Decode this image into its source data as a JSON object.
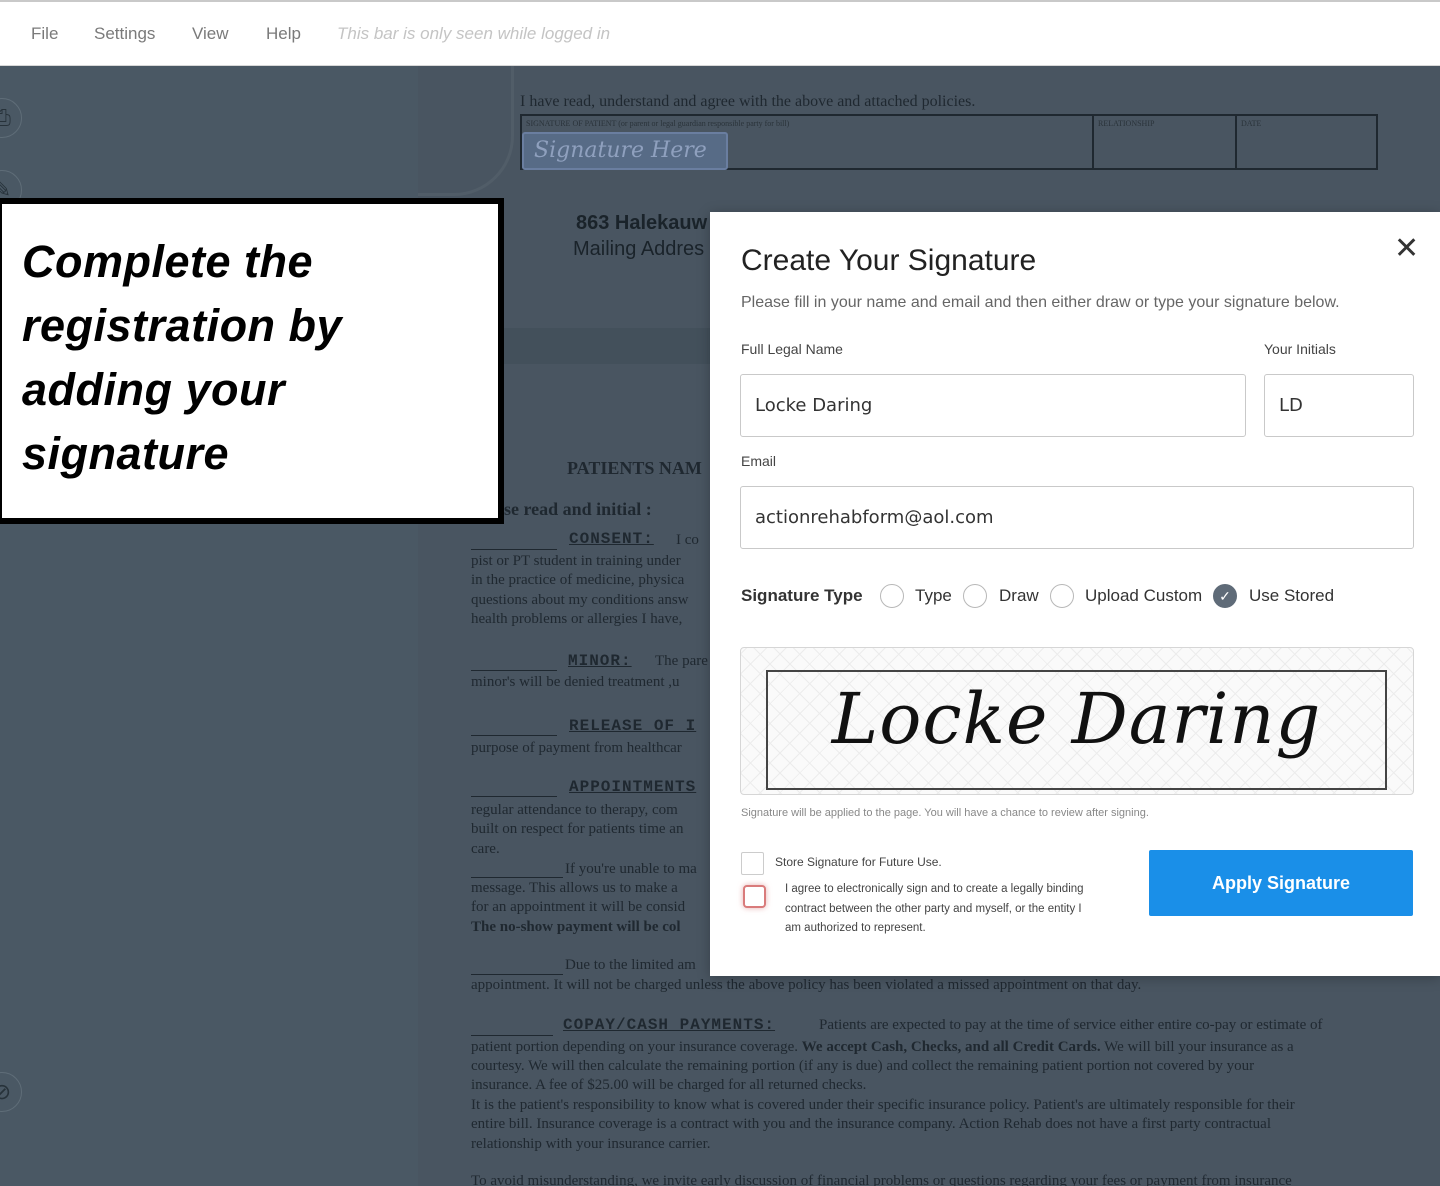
{
  "menubar": {
    "items": [
      "File",
      "Settings",
      "View",
      "Help"
    ],
    "note": "This bar is only seen while logged in"
  },
  "document": {
    "agree_line": "I have read, understand and agree with the above and attached policies.",
    "sig_header": "SIGNATURE OF PATIENT (or parent or legal guardian responsible party for bill)",
    "relationship_header": "RELATIONSHIP",
    "date_header": "DATE",
    "signature_here": "Signature Here",
    "address_line": "863 Halekauw",
    "mailing_line": "Mailing Addres",
    "patients_name": "PATIENTS NAM",
    "read_initial": "se read and initial :",
    "consent_head": "CONSENT:",
    "consent_lines": [
      "I co",
      "pist or PT student in training under",
      "in the practice of medicine, physica",
      "questions about my conditions answ",
      "health problems or allergies I have,"
    ],
    "minor_head": "MINOR:",
    "minor_lines": [
      "The pare",
      "minor's will be denied treatment ,u"
    ],
    "release_head": "RELEASE OF I",
    "release_line": "purpose of payment from healthcar",
    "appointments_head": "APPOINTMENTS",
    "appointments_lines": [
      "regular attendance to therapy, com",
      "built on respect for patients time an",
      "care."
    ],
    "unable_lines": [
      "If you're unable to ma",
      "message. This allows us to make a",
      "for an appointment it will be consid"
    ],
    "noshow_line": "The no-show payment will be col",
    "limited_line": "Due to the limited am",
    "appointment_line": "appointment. It will not be charged unless the above policy has been violated a missed  appointment on that day.",
    "copay_head": "COPAY/CASH PAYMENTS:",
    "copay_line1": "Patients are expected to pay at the time of service either entire co-pay or estimate of",
    "copay_line2a": "patient portion depending on your insurance coverage. ",
    "copay_line2b": "We accept Cash, Checks, and all Credit Cards.",
    "copay_line2c": " We will bill your insurance as a",
    "copay_lines_rest": [
      "courtesy. We will then calculate the remaining portion (if any is due) and collect the remaining patient portion not covered by your",
      "insurance. A fee of $25.00 will be charged for all returned checks.",
      "It is the patient's responsibility to know what is covered under their specific insurance policy. Patient's are ultimately responsible for their",
      "entire bill. Insurance coverage is a contract with you and the insurance company. Action Rehab does not have a first party contractual",
      "relationship with your insurance carrier."
    ],
    "last_line": "To avoid misunderstanding, we invite early discussion of financial problems or questions regarding your fees or payment from insurance"
  },
  "callout": {
    "lines": [
      "Complete the",
      "registration by",
      "adding your",
      "signature"
    ]
  },
  "modal": {
    "title": "Create Your Signature",
    "subtitle": "Please fill in your name and email and then either draw or type your signature below.",
    "close_glyph": "✕",
    "full_name_label": "Full Legal Name",
    "full_name_value": "Locke Daring",
    "initials_label": "Your Initials",
    "initials_value": "LD",
    "email_label": "Email",
    "email_value": "actionrehabform@aol.com",
    "signature_type_label": "Signature Type",
    "signature_types": [
      "Type",
      "Draw",
      "Upload Custom",
      "Use Stored"
    ],
    "selected_type": "Use Stored",
    "signature_preview": "Locke Daring",
    "apply_note": "Signature will be applied to the page. You will have a chance to review after signing.",
    "store_label": "Store Signature for Future Use.",
    "agree_text": "I agree to electronically sign and to create a legally binding contract between the other party and myself, or the entity I am authorized to represent.",
    "apply_button": "Apply Signature",
    "colors": {
      "accent": "#1a8fe8",
      "checked_radio": "#5f6b78",
      "error_outline": "#d97b7b"
    }
  }
}
